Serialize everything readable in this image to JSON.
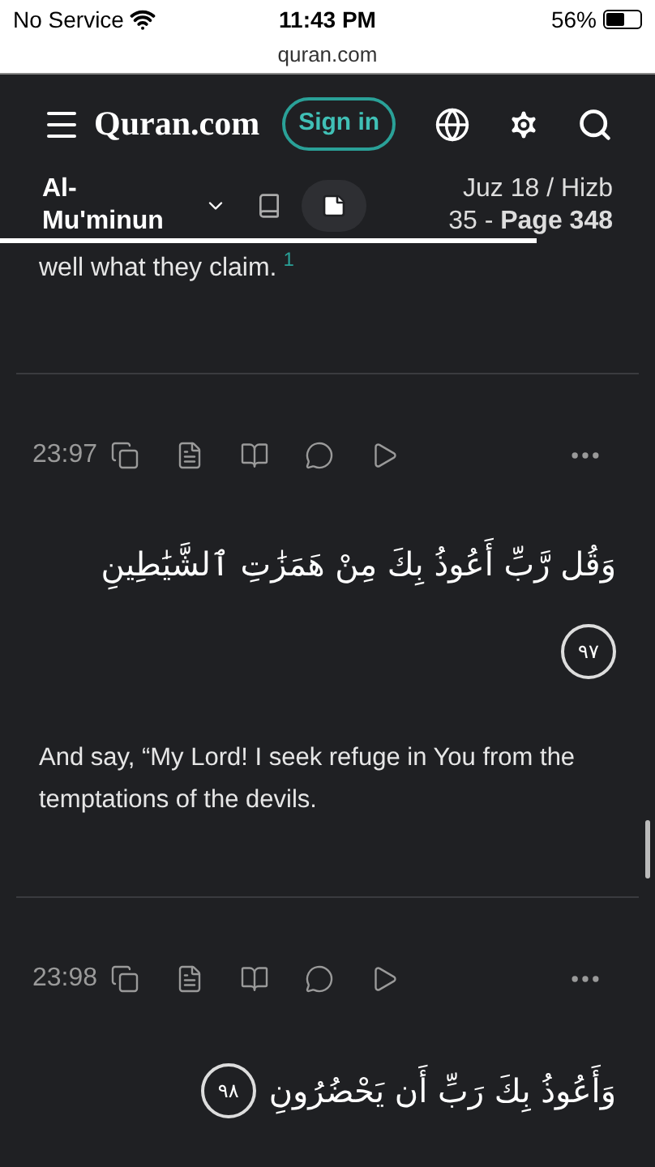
{
  "status_bar": {
    "carrier": "No Service",
    "time": "11:43 PM",
    "battery": "56%"
  },
  "address_bar": {
    "url": "quran.com"
  },
  "header": {
    "logo": "Quran.com",
    "sign_in": "Sign in"
  },
  "subheader": {
    "surah": "Al-Mu'minun",
    "modes": [
      {
        "kind": "book",
        "selected": false
      },
      {
        "kind": "page",
        "selected": true
      }
    ],
    "juz": "Juz 18 / Hizb 35 - **Page 348**",
    "level": 0.82
  },
  "previous_tail": {
    "text": "well what they claim.",
    "footnote": "1"
  },
  "verses": [
    {
      "key": "23:97",
      "arabic": "وَقُل رَّبِّ أَعُوذُ بِكَ مِنْ هَمَزَٰتِ ٱلشَّيَٰطِينِ",
      "number": "٩٧",
      "inline_number": false,
      "translation": "And say, “My Lord! I seek refuge in You from the temptations of the devils."
    },
    {
      "key": "23:98",
      "arabic": "وَأَعُوذُ بِكَ رَبِّ أَن يَحْضُرُونِ",
      "number": "٩٨",
      "inline_number": true
    }
  ]
}
